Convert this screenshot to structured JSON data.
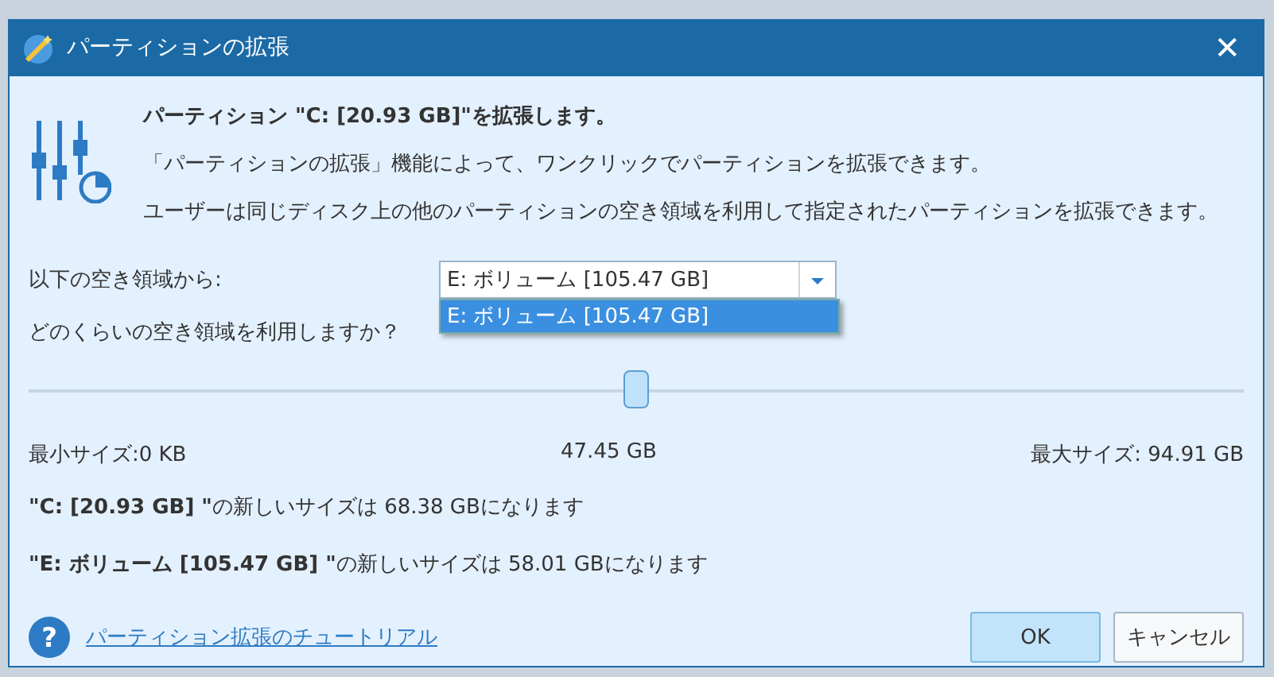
{
  "window": {
    "title": "パーティションの拡張",
    "close": "✕"
  },
  "heading": "パーティション \"C: [20.93 GB]\"を拡張します。",
  "description": [
    "「パーティションの拡張」機能によって、ワンクリックでパーティションを拡張できます。",
    "ユーザーは同じディスク上の他のパーティションの空き領域を利用して指定されたパーティションを拡張できます。"
  ],
  "source": {
    "label": "以下の空き領域から:",
    "value": "E: ボリューム [105.47 GB]",
    "expanded": true,
    "options": [
      {
        "label": "E: ボリューム [105.47 GB]",
        "selected": true
      }
    ]
  },
  "question": "どのくらいの空き領域を利用しますか？",
  "slider": {
    "level": 0.5,
    "min_label": "最小サイズ:0 KB",
    "current": "47.45 GB",
    "max_label": "最大サイズ: 94.91 GB"
  },
  "results": [
    "**\"C: [20.93 GB] \"**の新しいサイズは 68.38 GBになります",
    "**\"E: ボリューム [105.47 GB] \"**の新しいサイズは 58.01 GBになります"
  ],
  "help_icon": "?",
  "help_link": "パーティション拡張のチュートリアル",
  "buttons": [
    {
      "label": "OK",
      "kind": "primary"
    },
    {
      "label": "キャンセル",
      "kind": "secondary"
    }
  ]
}
